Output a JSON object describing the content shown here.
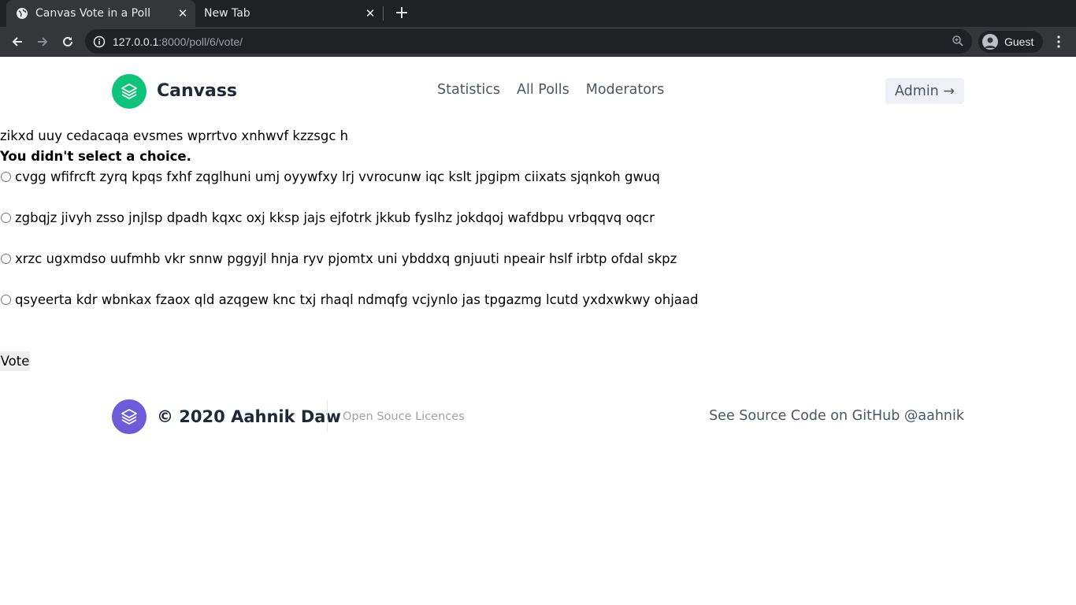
{
  "browser": {
    "tabs": [
      {
        "title": "Canvas Vote in a Poll",
        "active": true,
        "favicon": "globe-icon"
      },
      {
        "title": "New Tab",
        "active": false
      }
    ],
    "new_tab_icon": "plus-icon",
    "nav_icons": [
      "back-arrow-icon",
      "forward-arrow-icon",
      "reload-icon"
    ],
    "url": {
      "host": "127.0.0.1",
      "rest": ":8000/poll/6/vote/"
    },
    "profile_label": "Guest",
    "colors": {
      "tabstrip": "#202124",
      "toolbar": "#35363a",
      "omnibox": "#202124"
    }
  },
  "header": {
    "brand": "Canvass",
    "nav": [
      "Statistics",
      "All Polls",
      "Moderators"
    ],
    "admin_label": "Admin →",
    "logo_color": "#10c37a"
  },
  "poll": {
    "question": "zikxd uuy cedacaqa evsmes wprrtvo xnhwvf kzzsgc h",
    "error": "You didn't select a choice.",
    "choices": [
      "cvgg wfifrcft zyrq kpqs fxhf zqglhuni umj oyywfxy lrj vvrocunw iqc kslt jpgipm ciixats sjqnkoh gwuq",
      "zgbqjz jivyh zsso jnjlsp dpadh kqxc oxj kksp jajs ejfotrk jkkub fyslhz jokdqoj wafdbpu vrbqqvq oqcr",
      "xrzc ugxmdso uufmhb vkr snnw pggyjl hnja ryv pjomtx uni ybddxq gnjuuti npeair hslf irbtp ofdal skpz",
      "qsyeerta kdr wbnkax fzaox qld azqgew knc txj rhaql ndmqfg vcjynlo jas tpgazmg lcutd yxdxwkwy ohjaad"
    ],
    "vote_label": "Vote"
  },
  "footer": {
    "copyright": "© 2020 Aahnik Daw",
    "licences": "Open Souce Licences",
    "source": "See Source Code on GitHub @aahnik",
    "logo_color": "#6d5bd8"
  }
}
